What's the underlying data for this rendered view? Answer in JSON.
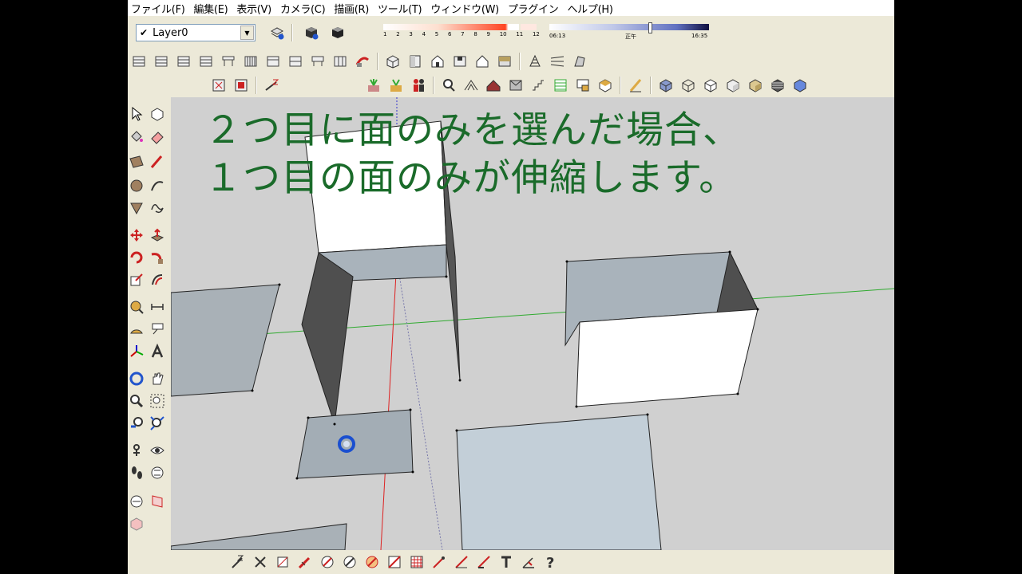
{
  "menu": {
    "items": [
      "ファイル(F)",
      "編集(E)",
      "表示(V)",
      "カメラ(C)",
      "描画(R)",
      "ツール(T)",
      "ウィンドウ(W)",
      "プラグイン",
      "ヘルプ(H)"
    ]
  },
  "layer": {
    "check": "✔",
    "current": "Layer0"
  },
  "shadow": {
    "month_ticks": [
      "1",
      "2",
      "3",
      "4",
      "5",
      "6",
      "7",
      "8",
      "9",
      "10",
      "11",
      "12"
    ],
    "time_start": "06:13",
    "time_mid": "正午",
    "time_end": "16:35"
  },
  "viewport": {
    "instruction_line1": "２つ目に面のみを選んだ場合、",
    "instruction_line2": "１つ目の面のみが伸縮します。"
  },
  "colors": {
    "instruction_text": "#1a6b2a",
    "face_front": "#a9b3bb",
    "face_white": "#ffffff",
    "face_dark": "#555555",
    "axis_red": "#cc0000",
    "axis_green": "#00aa00",
    "axis_blue": "#0000cc"
  },
  "icons": {
    "left_toolbar": [
      "select-icon",
      "component-icon",
      "paint-bucket-icon",
      "eraser-icon",
      "rectangle-icon",
      "pencil-icon",
      "circle-icon",
      "arc-icon",
      "polygon-icon",
      "freehand-icon",
      "move-icon",
      "push-pull-icon",
      "rotate-icon",
      "follow-me-icon",
      "scale-icon",
      "offset-icon",
      "tape-measure-icon",
      "dimension-icon",
      "protractor-icon",
      "text-icon",
      "axes-icon",
      "3d-text-icon",
      "orbit-icon",
      "pan-icon",
      "zoom-icon",
      "zoom-window-icon",
      "previous-view-icon",
      "zoom-extents-icon",
      "position-camera-icon",
      "look-around-icon",
      "walk-icon",
      "section-plane-icon"
    ]
  }
}
